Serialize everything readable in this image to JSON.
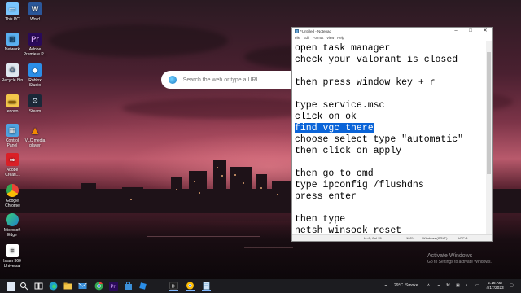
{
  "desktop_icons": [
    {
      "label": "This PC",
      "icon": "monitor-icon",
      "color": "#7ac6ff"
    },
    {
      "label": "Word",
      "icon": "word-icon",
      "color": "#2b579a"
    },
    {
      "label": "Network",
      "icon": "network-icon",
      "color": "#5ab0f0"
    },
    {
      "label": "Adobe Premiere P...",
      "icon": "premiere-icon",
      "color": "#2a0a5a"
    },
    {
      "label": "Recycle Bin",
      "icon": "recycle-bin-icon",
      "color": "#dfe8f0"
    },
    {
      "label": "Roblox Studio",
      "icon": "roblox-studio-icon",
      "color": "#2b8ee8"
    },
    {
      "label": "lenovo",
      "icon": "folder-icon",
      "color": "#f3c64a"
    },
    {
      "label": "Steam",
      "icon": "steam-icon",
      "color": "#1b2838"
    },
    {
      "label": "Control Panel",
      "icon": "control-panel-icon",
      "color": "#4fa3e0"
    },
    {
      "label": "VLC media player",
      "icon": "vlc-icon",
      "color": "#f28a00"
    },
    {
      "label": "Adobe Creati...",
      "icon": "adobe-cc-icon",
      "color": "#da1f26"
    },
    {
      "label": "Google Chrome",
      "icon": "chrome-icon",
      "color": "#34a853"
    },
    {
      "label": "Microsoft Edge",
      "icon": "edge-icon",
      "color": "#1fa0c8"
    },
    {
      "label": "Islam 360 Universal",
      "icon": "document-icon",
      "color": "#ffffff"
    }
  ],
  "search": {
    "placeholder": "Search the web or type a URL"
  },
  "notepad": {
    "title": "*Untitled - Notepad",
    "menu": [
      "File",
      "Edit",
      "Format",
      "View",
      "Help"
    ],
    "lines": [
      {
        "text": "open task manager"
      },
      {
        "text": "check your valorant is closed"
      },
      {
        "text": ""
      },
      {
        "text": "then press window key + r"
      },
      {
        "text": ""
      },
      {
        "text": "type service.msc"
      },
      {
        "text": "click on ok"
      },
      {
        "text": "find vgc there",
        "selected": true
      },
      {
        "text": "choose select type \"automatic\""
      },
      {
        "text": "then click on apply"
      },
      {
        "text": ""
      },
      {
        "text": "then go to cmd"
      },
      {
        "text": "type ipconfig /flushdns"
      },
      {
        "text": "press enter"
      },
      {
        "text": ""
      },
      {
        "text": "then type"
      },
      {
        "text": "netsh winsock reset"
      }
    ],
    "status": {
      "position": "Ln 8, Col 15",
      "zoom": "100%",
      "line_ending": "Windows (CRLF)",
      "encoding": "UTF-8"
    }
  },
  "watermark": {
    "line1": "Activate Windows",
    "line2": "Go to Settings to activate Windows."
  },
  "taskbar": {
    "weather_temp": "29°C",
    "weather_text": "Smoke",
    "time": "2:16 AM",
    "date": "4/17/2023",
    "accent": "#7fb7ff"
  }
}
